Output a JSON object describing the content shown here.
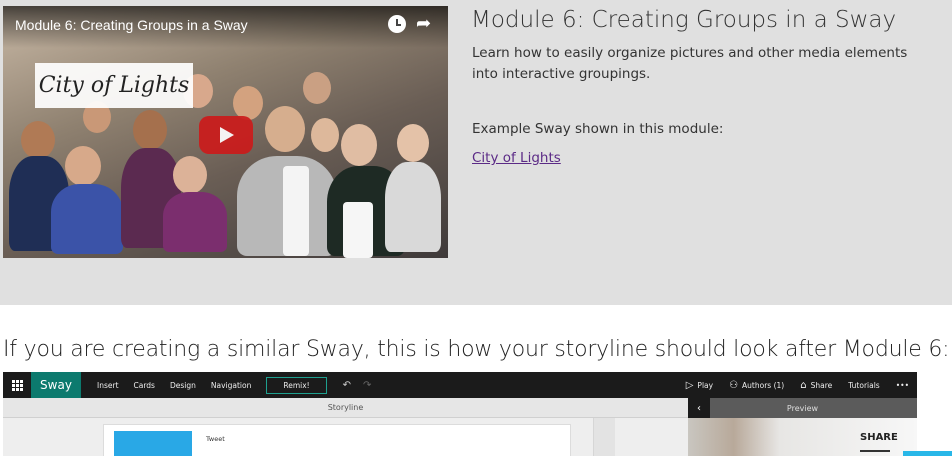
{
  "video": {
    "title": "Module 6: Creating Groups in a Sway",
    "overlay_label": "City of Lights",
    "icons": [
      "clock-icon",
      "share-arrow-icon",
      "play-icon"
    ]
  },
  "module": {
    "title": "Module 6: Creating Groups in a Sway",
    "description": "Learn how to easily organize pictures and other media elements into interactive groupings.",
    "example_label": "Example Sway shown in this module:",
    "example_link": "City of Lights"
  },
  "storyline_heading": "If you are creating a similar Sway, this is how your storyline should look after Module 6:",
  "sway_app": {
    "brand": "Sway",
    "menu": [
      "Insert",
      "Cards",
      "Design",
      "Navigation"
    ],
    "remix_label": "Remix!",
    "right_menu": [
      {
        "icon": "play-icon",
        "label": "Play"
      },
      {
        "icon": "authors-icon",
        "label": "Authors (1)"
      },
      {
        "icon": "share-icon",
        "label": "Share"
      },
      {
        "icon": "",
        "label": "Tutorials"
      },
      {
        "icon": "",
        "label": "•••"
      }
    ],
    "storyline_label": "Storyline",
    "preview_label": "Preview",
    "back_glyph": "‹",
    "card_label": "Tweet",
    "preview_share": "SHARE",
    "accent": "#0c7a6e"
  }
}
